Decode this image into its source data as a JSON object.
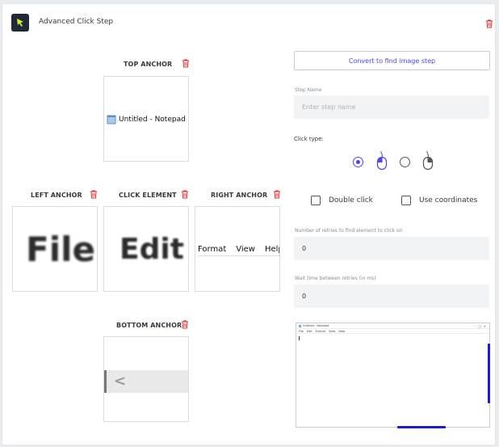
{
  "header": {
    "title": "Advanced Click Step",
    "logo_icon": "cursor-arrow-icon",
    "delete_icon": "trash-icon"
  },
  "anchors": {
    "top": {
      "label": "TOP ANCHOR",
      "content": "Untitled - Notepad"
    },
    "left": {
      "label": "LEFT ANCHOR",
      "content": "File"
    },
    "click": {
      "label": "CLICK ELEMENT",
      "content": "Edit"
    },
    "right": {
      "label": "RIGHT ANCHOR",
      "menu": [
        "Format",
        "View",
        "Help"
      ]
    },
    "bottom": {
      "label": "BOTTOM ANCHOR",
      "content": "<"
    }
  },
  "form": {
    "convert_button": "Convert to find image step",
    "step_name_label": "Step Name",
    "step_name_placeholder": "Enter step name",
    "click_type_label": "Click type:",
    "click_type_selected": "left",
    "double_click_label": "Double click",
    "use_coordinates_label": "Use coordinates",
    "retries_label": "Number of retries to find element to click on",
    "retries_value": "0",
    "wait_label": "Wait time between retries (in ms)",
    "wait_value": "0"
  },
  "preview": {
    "window_title": "Untitled - Notepad",
    "menu": [
      "File",
      "Edit",
      "Format",
      "View",
      "Help"
    ]
  },
  "colors": {
    "accent": "#4f46e5",
    "danger": "#e03131",
    "logo_bg": "#1f2937",
    "logo_fg": "#d4f31d"
  }
}
